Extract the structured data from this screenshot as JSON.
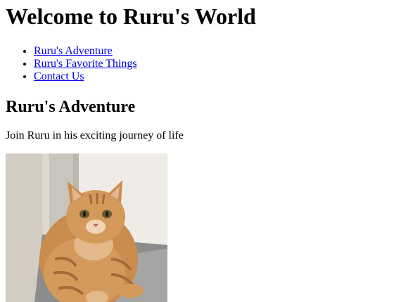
{
  "header": {
    "title": "Welcome to Ruru's World"
  },
  "nav": {
    "items": [
      {
        "label": "Ruru's Adventure"
      },
      {
        "label": "Ruru's Favorite Things"
      },
      {
        "label": "Contact Us"
      }
    ]
  },
  "section": {
    "heading": "Ruru's Adventure",
    "text": "Join Ruru in his exciting journey of life",
    "image": {
      "icon": "cat-photo"
    }
  },
  "colors": {
    "link": "#0000ee",
    "text": "#000000",
    "background": "#ffffff"
  }
}
